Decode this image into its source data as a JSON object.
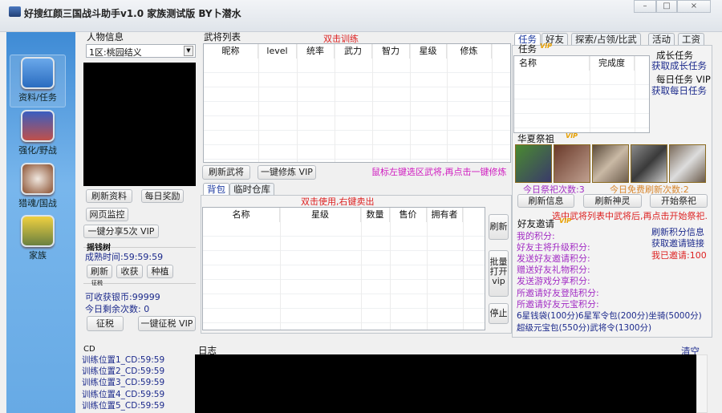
{
  "window": {
    "title": "好搜红颜三国战斗助手v1.0 家族测试版 BY卜潜水",
    "minimize": "–",
    "maximize": "□",
    "close": "×"
  },
  "sidebar": {
    "items": [
      {
        "label": "资料/任务",
        "icon": "home-icon",
        "color": "#3a7fd0"
      },
      {
        "label": "强化/野战",
        "icon": "people-icon",
        "color": "#c0504a"
      },
      {
        "label": "猎魂/国战",
        "icon": "soul-icon",
        "color": "#8a5030"
      },
      {
        "label": "家族",
        "icon": "family-icon",
        "color": "#d8b020"
      }
    ]
  },
  "profile": {
    "title": "人物信息",
    "server": "1区:桃园结义",
    "refresh": "刷新资料",
    "daily_reward": "每日奖励",
    "web_monitor": "网页监控",
    "share": "一键分享5次 VIP"
  },
  "money_tree": {
    "title": "摇钱树",
    "mature_label": "成熟时间",
    "mature_time": "59:59:59",
    "refresh": "刷新",
    "harvest": "收获",
    "plant": "种植"
  },
  "tax": {
    "title": "征税",
    "silver_label": "可收获银币",
    "silver": "99999",
    "remaining_label": "今日剩余次数:",
    "remaining": "0",
    "collect": "征税",
    "collect_all": "一键征税 VIP"
  },
  "generals": {
    "title": "武将列表",
    "hint": "双击训练",
    "columns": [
      "昵称",
      "level",
      "统率",
      "武力",
      "智力",
      "星级",
      "修炼"
    ],
    "refresh": "刷新武将",
    "train_all": "一键修炼 VIP",
    "train_hint": "鼠标左键选区武将,再点击一键修炼"
  },
  "bag": {
    "tabs": [
      "背包",
      "临时仓库"
    ],
    "hint": "双击使用,右键卖出",
    "columns": [
      "名称",
      "星级",
      "数量",
      "售价",
      "拥有者"
    ],
    "refresh": "刷新",
    "batch_open": "批量打开vip",
    "stop": "停止"
  },
  "right_tabs": [
    "任务",
    "好友",
    "探索/占领/比武",
    "活动",
    "工资"
  ],
  "tasks": {
    "title": "任务",
    "vip": "VIP",
    "columns": [
      "名称",
      "完成度"
    ],
    "growth_title": "成长任务",
    "get_growth": "获取成长任务",
    "daily_title": "每日任务 VIP",
    "get_daily": "获取每日任务"
  },
  "worship": {
    "title": "华夏祭祖",
    "vip": "VIP",
    "count_label": "今日祭祀次数:",
    "count": "3",
    "free_label": "今日免费刷新次数:",
    "free": "2",
    "refresh_info": "刷新信息",
    "refresh_god": "刷新神灵",
    "start": "开始祭祀",
    "hint": "选中武将列表中武将后,再点击开始祭祀."
  },
  "invite": {
    "title": "好友邀请",
    "vip": "VIP",
    "items": [
      "我的积分:",
      "好友主将升级积分:",
      "发送好友邀请积分:",
      "赠送好友礼物积分:",
      "发送游戏分享积分:",
      "所邀请好友登陆积分:",
      "所邀请好友元宝积分:"
    ],
    "refresh": "刷新积分信息",
    "get_link": "获取邀请链接",
    "invited_label": "我已邀请:",
    "invited": "100",
    "rewards1": "6星钱袋(100分)6星军令包(200分)坐骑(5000分)",
    "rewards2": "超级元宝包(550分)武将令(1300分)"
  },
  "cd": {
    "title": "CD",
    "items": [
      "训练位置1_CD:59:59",
      "训练位置2_CD:59:59",
      "训练位置3_CD:59:59",
      "训练位置4_CD:59:59",
      "训练位置5_CD:59:59"
    ]
  },
  "log": {
    "title": "日志",
    "clear": "清空"
  }
}
